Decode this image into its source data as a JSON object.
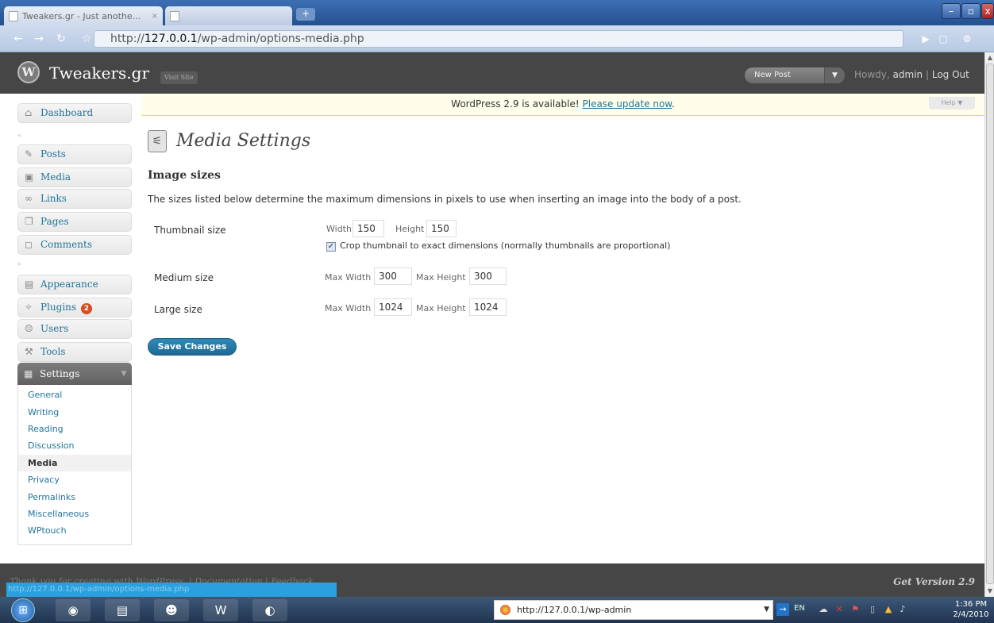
{
  "browser": {
    "tabs": [
      {
        "label": "Tweakers.gr - Just anothe...",
        "active": true
      },
      {
        "label": "",
        "active": false
      }
    ],
    "url_prefix": "http://",
    "url_host": "127.0.0.1",
    "url_path": "/wp-admin/options-media.php",
    "status_url": "http://127.0.0.1/wp-admin/options-media.php"
  },
  "wp_header": {
    "site_title": "Tweakers.gr",
    "visit_site": "Visit Site",
    "new_post": "New Post",
    "howdy_prefix": "Howdy,",
    "username": "admin",
    "separator": "|",
    "logout": "Log Out"
  },
  "nag": {
    "text": "WordPress 2.9 is available!",
    "link": "Please update now",
    "suffix": "."
  },
  "help": "Help",
  "sidebar": {
    "items": [
      {
        "label": "Dashboard",
        "icon": "home-icon"
      },
      {
        "label": "Posts",
        "icon": "pin-icon"
      },
      {
        "label": "Media",
        "icon": "camera-icon"
      },
      {
        "label": "Links",
        "icon": "link-icon"
      },
      {
        "label": "Pages",
        "icon": "pages-icon"
      },
      {
        "label": "Comments",
        "icon": "comment-icon"
      },
      {
        "label": "Appearance",
        "icon": "appearance-icon"
      },
      {
        "label": "Plugins",
        "icon": "plug-icon",
        "badge": "2"
      },
      {
        "label": "Users",
        "icon": "users-icon"
      },
      {
        "label": "Tools",
        "icon": "tools-icon"
      }
    ],
    "settings": {
      "label": "Settings",
      "icon": "settings-icon"
    },
    "submenu": [
      "General",
      "Writing",
      "Reading",
      "Discussion",
      "Media",
      "Privacy",
      "Permalinks",
      "Miscellaneous",
      "WPtouch"
    ],
    "current_submenu": "Media"
  },
  "main": {
    "title": "Media Settings",
    "section_title": "Image sizes",
    "section_desc": "The sizes listed below determine the maximum dimensions in pixels to use when inserting an image into the body of a post.",
    "thumbnail": {
      "label": "Thumbnail size",
      "width_label": "Width",
      "width_value": "150",
      "height_label": "Height",
      "height_value": "150",
      "crop_checked": true,
      "crop_label": "Crop thumbnail to exact dimensions (normally thumbnails are proportional)"
    },
    "medium": {
      "label": "Medium size",
      "width_label": "Max Width",
      "width_value": "300",
      "height_label": "Max Height",
      "height_value": "300"
    },
    "large": {
      "label": "Large size",
      "width_label": "Max Width",
      "width_value": "1024",
      "height_label": "Max Height",
      "height_value": "1024"
    },
    "save_label": "Save Changes"
  },
  "footer": {
    "left": "Thank you for creating with WordPress. | Documentation | Feedback",
    "right": "Get Version 2.9"
  },
  "taskbar": {
    "task_label": "http://127.0.0.1/wp-admin",
    "lang": "EN",
    "time": "1:36 PM",
    "date": "2/4/2010"
  },
  "colors": {
    "link": "#21759b",
    "header_bg": "#464646",
    "nag_bg": "#fffeeb",
    "save_button": "#21759b",
    "badge": "#d54e21"
  }
}
